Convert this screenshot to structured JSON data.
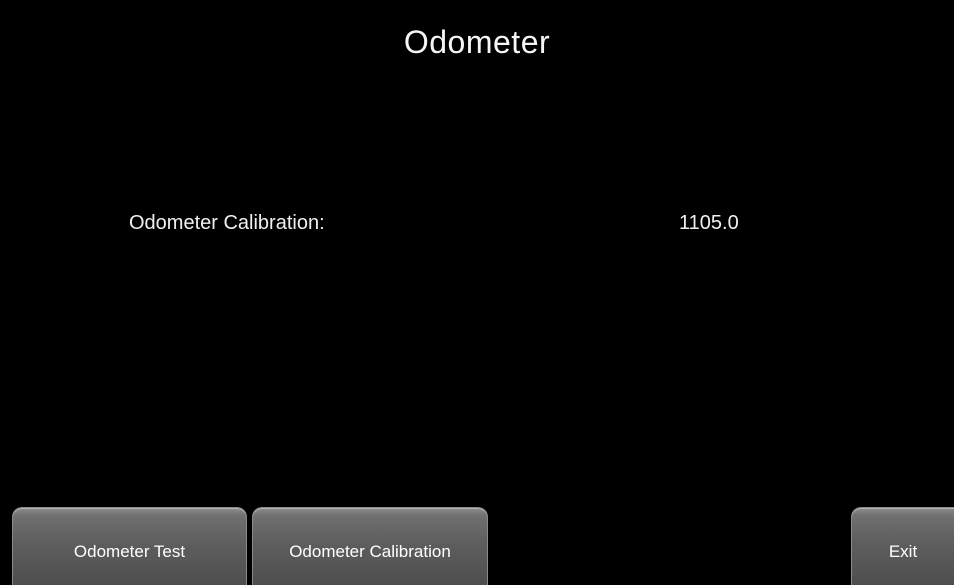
{
  "header": {
    "title": "Odometer"
  },
  "settings": {
    "odometer_calibration": {
      "label": "Odometer Calibration:",
      "value": "1105.0"
    }
  },
  "softkeys": {
    "odometer_test": "Odometer Test",
    "odometer_calibration": "Odometer Calibration",
    "exit": "Exit"
  },
  "colors": {
    "background": "#000000",
    "text": "#f2f2f2",
    "button_top": "#8e8e8e",
    "button_bottom": "#4e4e4e"
  }
}
